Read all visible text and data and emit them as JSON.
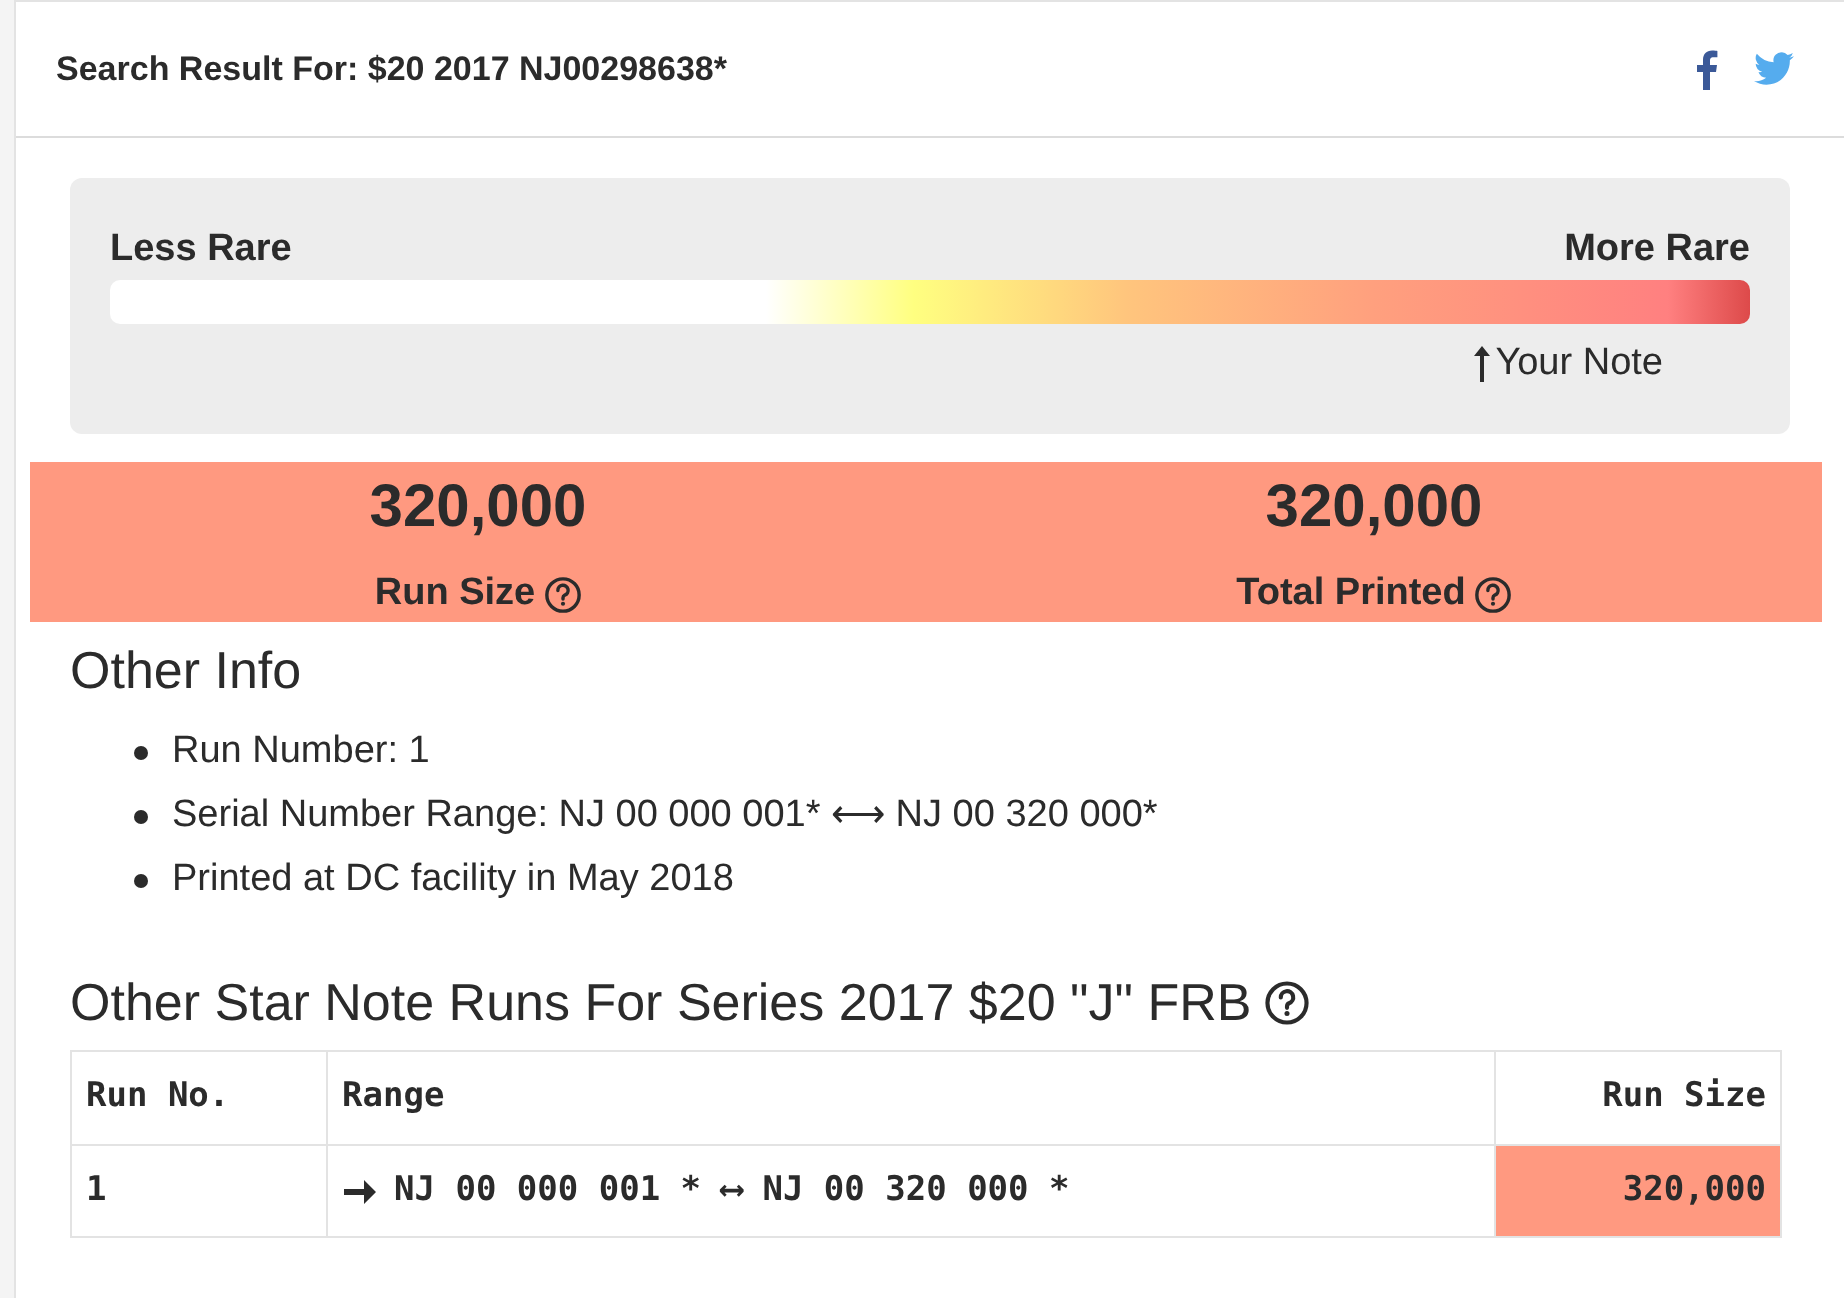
{
  "header": {
    "title": "Search Result For: $20 2017 NJ00298638*"
  },
  "rarity": {
    "less_label": "Less Rare",
    "more_label": "More Rare",
    "marker_label": "Your Note",
    "level": 0.835
  },
  "stats": [
    {
      "value": "320,000",
      "label": "Run Size"
    },
    {
      "value": "320,000",
      "label": "Total Printed"
    }
  ],
  "other_info": {
    "heading": "Other Info",
    "items": [
      "Run Number: 1",
      "Serial Number Range: NJ 00 000 001* ⟷ NJ 00 320 000*",
      "Printed at DC facility in May 2018"
    ]
  },
  "runs": {
    "heading": "Other Star Note Runs For Series 2017 $20 \"J\" FRB",
    "columns": [
      "Run No.",
      "Range",
      "Run Size"
    ],
    "rows": [
      {
        "run": "1",
        "range": "NJ 00 000 001 * ⟷ NJ 00 320 000 *",
        "size": "320,000",
        "current": true
      }
    ]
  }
}
